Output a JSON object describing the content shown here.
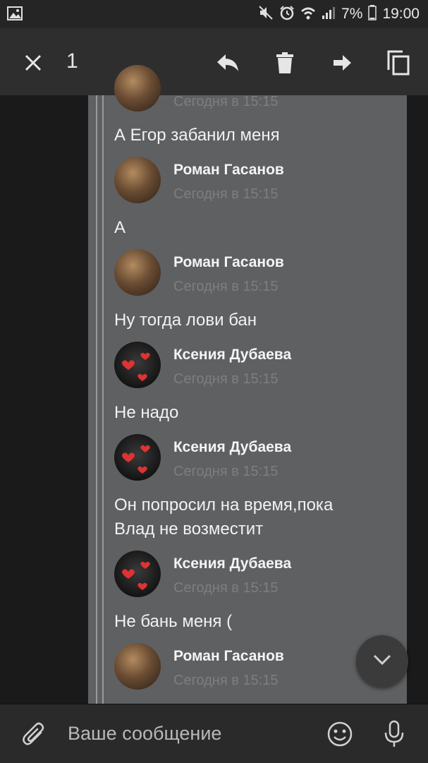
{
  "status_bar": {
    "battery_percent": "7%",
    "time": "19:00",
    "icons": [
      "gallery-icon",
      "mute-icon",
      "alarm-icon",
      "wifi-icon",
      "signal-icon",
      "battery-icon"
    ]
  },
  "action_bar": {
    "selected_count": "1",
    "icons": [
      "close-icon",
      "reply-icon",
      "delete-icon",
      "forward-icon",
      "copy-icon"
    ]
  },
  "messages": [
    {
      "type": "time",
      "time": "Сегодня в 15:15"
    },
    {
      "type": "text",
      "text": "А Егор забанил меня"
    },
    {
      "type": "header",
      "author": "Роман Гасанов",
      "time": "Сегодня в 15:15"
    },
    {
      "type": "text",
      "text": "А"
    },
    {
      "type": "header",
      "author": "Роман Гасанов",
      "time": "Сегодня в 15:15"
    },
    {
      "type": "text",
      "text": "Ну тогда лови бан"
    },
    {
      "type": "header",
      "author": "Ксения Дубаева",
      "time": "Сегодня в 15:15"
    },
    {
      "type": "text",
      "text": "Не надо"
    },
    {
      "type": "header",
      "author": "Ксения Дубаева",
      "time": "Сегодня в 15:15"
    },
    {
      "type": "text",
      "lines": [
        "Он попросил на время,пока",
        "Влад не возместит"
      ]
    },
    {
      "type": "header",
      "author": "Ксения Дубаева",
      "time": "Сегодня в 15:15"
    },
    {
      "type": "text",
      "text": "Не бань меня ("
    },
    {
      "type": "header",
      "author": "Роман Гасанов",
      "time": "Сегодня в 15:15"
    }
  ],
  "composer": {
    "placeholder": "Ваше сообщение",
    "icons": [
      "attach-icon",
      "emoji-icon",
      "microphone-icon"
    ]
  },
  "colors": {
    "bubble": "#5f6062",
    "quote_line": "#9a9a9c",
    "time_text": "#7d7e80"
  }
}
